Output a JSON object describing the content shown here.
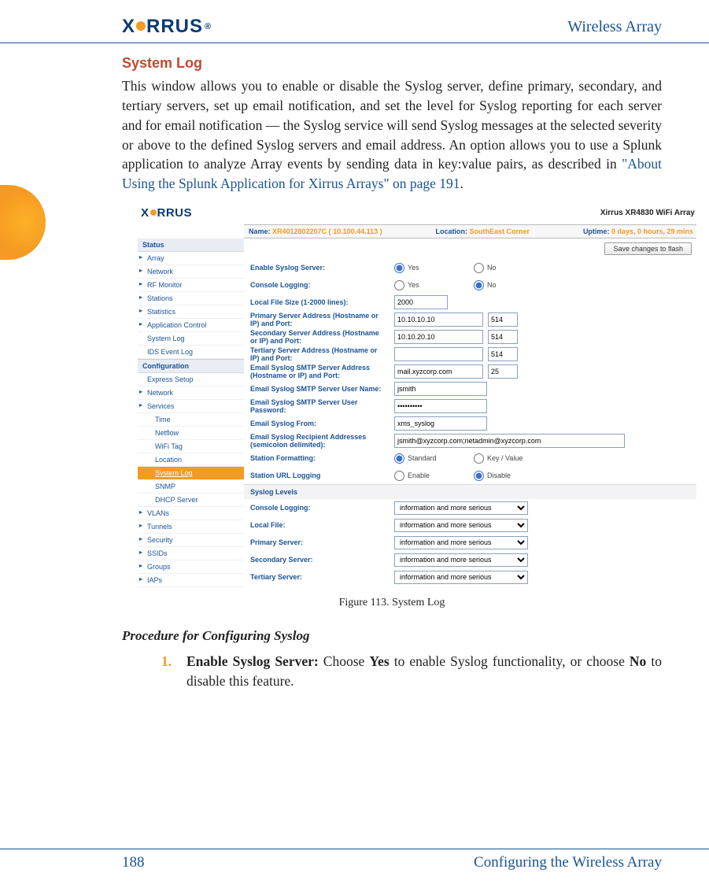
{
  "header": {
    "brand": "XIRRUS",
    "doc_title": "Wireless Array"
  },
  "section_title": "System Log",
  "intro_part1": "This window allows you to enable or disable the Syslog server, define primary, secondary, and tertiary servers, set up email notification, and set the level for Syslog reporting for each server and for email notification — the Syslog service will send Syslog messages at the selected severity or above to the defined Syslog servers and email address. An option allows you to use a Splunk application to analyze Array events by sending data in key:value pairs, as described in ",
  "intro_link": "\"About Using the Splunk Application for Xirrus Arrays\" on page 191",
  "intro_part2": ".",
  "figure": {
    "caption": "Figure 113. System Log",
    "brand": "XIRRUS",
    "model": "Xirrus XR4830 WiFi Array",
    "topbar": {
      "name_k": "Name:",
      "name_v": "XR4012802207C   ( 10.100.44.113 )",
      "loc_k": "Location:",
      "loc_v": "SouthEast Corner",
      "up_k": "Uptime:",
      "up_v": "0 days, 0 hours, 29 mins"
    },
    "save_button": "Save changes to flash",
    "nav": {
      "status": "Status",
      "status_items": [
        "Array",
        "Network",
        "RF Monitor",
        "Stations",
        "Statistics",
        "Application Control",
        "System Log",
        "IDS Event Log"
      ],
      "config": "Configuration",
      "config_items": [
        "Express Setup",
        "Network",
        "Services"
      ],
      "services": [
        "Time",
        "Netflow",
        "WiFi Tag",
        "Location",
        "System Log",
        "SNMP",
        "DHCP Server"
      ],
      "selected_service": "System Log",
      "config_tail": [
        "VLANs",
        "Tunnels",
        "Security",
        "SSIDs",
        "Groups",
        "IAPs"
      ]
    },
    "form": {
      "r1_label": "Enable Syslog Server:",
      "yes": "Yes",
      "no": "No",
      "r2_label": "Console Logging:",
      "r3_label": "Local File Size (1-2000 lines):",
      "r3_val": "2000",
      "r4_label": "Primary Server Address (Hostname or IP) and Port:",
      "r4_addr": "10.10.10.10",
      "r4_port": "514",
      "r5_label": "Secondary Server Address (Hostname or IP) and Port:",
      "r5_addr": "10.10.20.10",
      "r5_port": "514",
      "r6_label": "Tertiary Server Address (Hostname or IP) and Port:",
      "r6_addr": "",
      "r6_port": "514",
      "r7_label": "Email Syslog SMTP Server Address (Hostname or IP) and Port:",
      "r7_addr": "mail.xyzcorp.com",
      "r7_port": "25",
      "r8_label": "Email Syslog SMTP Server User Name:",
      "r8_val": "jsmith",
      "r9_label": "Email Syslog SMTP Server User Password:",
      "r9_val": "••••••••••",
      "r10_label": "Email Syslog From:",
      "r10_val": "xms_syslog",
      "r11_label": "Email Syslog Recipient Addresses (semicolon delimited):",
      "r11_val": "jsmith@xyzcorp.com;netadmin@xyzcorp.com",
      "r12_label": "Station Formatting:",
      "r12_a": "Standard",
      "r12_b": "Key / Value",
      "r13_label": "Station URL Logging",
      "r13_a": "Enable",
      "r13_b": "Disable",
      "levels_head": "Syslog Levels",
      "lv1_label": "Console Logging:",
      "lv2_label": "Local File:",
      "lv3_label": "Primary Server:",
      "lv4_label": "Secondary Server:",
      "lv5_label": "Tertiary Server:",
      "level_option": "information and more serious"
    }
  },
  "procedure": {
    "heading": "Procedure for Configuring Syslog",
    "num": "1.",
    "lead": "Enable Syslog Server: ",
    "text1": "Choose ",
    "b1": "Yes",
    "text2": " to enable Syslog functionality, or choose ",
    "b2": "No",
    "text3": " to disable this feature."
  },
  "footer": {
    "page_no": "188",
    "chapter": "Configuring the Wireless Array"
  }
}
